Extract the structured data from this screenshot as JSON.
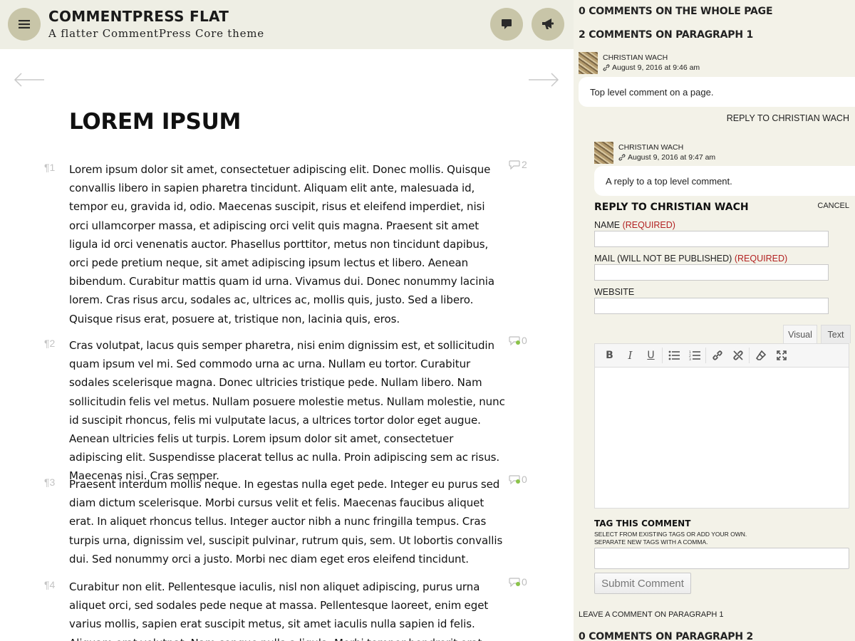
{
  "header": {
    "site_title": "COMMENTPRESS FLAT",
    "site_description": "A flatter CommentPress Core theme",
    "menu_icon": "hamburger-menu-icon",
    "comments_icon": "speech-bubble-icon",
    "activity_icon": "megaphone-icon"
  },
  "page": {
    "title": "LOREM IPSUM",
    "prev_icon": "left-arrow-icon",
    "next_icon": "right-arrow-icon",
    "paragraphs": [
      {
        "num": "¶1",
        "comments": "2",
        "text": "Lorem ipsum dolor sit amet, consectetuer adipiscing elit. Donec mollis. Quisque convallis libero in sapien pharetra tincidunt. Aliquam elit ante, malesuada id, tempor eu, gravida id, odio. Maecenas suscipit, risus et eleifend imperdiet, nisi orci ullamcorper massa, et adipiscing orci velit quis magna. Praesent sit amet ligula id orci venenatis auctor. Phasellus porttitor, metus non tincidunt dapibus, orci pede pretium neque, sit amet adipiscing ipsum lectus et libero. Aenean bibendum. Curabitur mattis quam id urna. Vivamus dui. Donec nonummy lacinia lorem. Cras risus arcu, sodales ac, ultrices ac, mollis quis, justo. Sed a libero. Quisque risus erat, posuere at, tristique non, lacinia quis, eros."
      },
      {
        "num": "¶2",
        "comments": "0",
        "text": "Cras volutpat, lacus quis semper pharetra, nisi enim dignissim est, et sollicitudin quam ipsum vel mi. Sed commodo urna ac urna. Nullam eu tortor. Curabitur sodales scelerisque magna. Donec ultricies tristique pede. Nullam libero. Nam sollicitudin felis vel metus. Nullam posuere molestie metus. Nullam molestie, nunc id suscipit rhoncus, felis mi vulputate lacus, a ultrices tortor dolor eget augue. Aenean ultricies felis ut turpis. Lorem ipsum dolor sit amet, consectetuer adipiscing elit. Suspendisse placerat tellus ac nulla. Proin adipiscing sem ac risus. Maecenas nisi. Cras semper."
      },
      {
        "num": "¶3",
        "comments": "0",
        "text": "Praesent interdum mollis neque. In egestas nulla eget pede. Integer eu purus sed diam dictum scelerisque. Morbi cursus velit et felis. Maecenas faucibus aliquet erat. In aliquet rhoncus tellus. Integer auctor nibh a nunc fringilla tempus. Cras turpis urna, dignissim vel, suscipit pulvinar, rutrum quis, sem. Ut lobortis convallis dui. Sed nonummy orci a justo. Morbi nec diam eget eros eleifend tincidunt."
      },
      {
        "num": "¶4",
        "comments": "0",
        "text": "Curabitur non elit. Pellentesque iaculis, nisl non aliquet adipiscing, purus urna aliquet orci, sed sodales pede neque at massa. Pellentesque laoreet, enim eget varius mollis, sapien erat suscipit metus, sit amet iaculis nulla sapien id felis. Aliquam erat volutpat. Nam congue nulla a ligula. Morbi tempor hendrerit erat. Curabitur augue. Vestibulum"
      }
    ]
  },
  "sidebar": {
    "whole_page_heading": "0 COMMENTS ON THE WHOLE PAGE",
    "para1_heading": "2 COMMENTS ON PARAGRAPH 1",
    "comments": [
      {
        "author": "CHRISTIAN WACH",
        "date": "August 9, 2016 at 9:46 am",
        "body": "Top level comment on a page.",
        "reply": "REPLY TO CHRISTIAN WACH"
      },
      {
        "author": "CHRISTIAN WACH",
        "date": "August 9, 2016 at 9:47 am",
        "body": "A reply to a top level comment."
      }
    ],
    "form": {
      "title": "REPLY TO CHRISTIAN WACH",
      "cancel": "CANCEL",
      "name_label": "NAME",
      "mail_label": "MAIL (WILL NOT BE PUBLISHED)",
      "website_label": "WEBSITE",
      "required": "(REQUIRED)",
      "name_value": "",
      "mail_value": "",
      "website_value": "",
      "tab_visual": "Visual",
      "tab_text": "Text",
      "toolbar": [
        "bold",
        "italic",
        "underline",
        "bulleted-list",
        "numbered-list",
        "link",
        "unlink",
        "clear-formatting",
        "fullscreen"
      ],
      "comment_value": "",
      "tag_title": "TAG THIS COMMENT",
      "tag_help_1": "SELECT FROM EXISTING TAGS OR ADD YOUR OWN.",
      "tag_help_2": "SEPARATE NEW TAGS WITH A COMMA.",
      "tag_value": "",
      "submit": "Submit Comment"
    },
    "leave_comment": "LEAVE A COMMENT ON PARAGRAPH 1",
    "para2_heading": "0 COMMENTS ON PARAGRAPH 2"
  },
  "colors": {
    "header_bg": "#eeeee4",
    "sidebar_bg": "#f3f2e8",
    "round_button": "#c8c5a8",
    "required": "#b22222"
  }
}
